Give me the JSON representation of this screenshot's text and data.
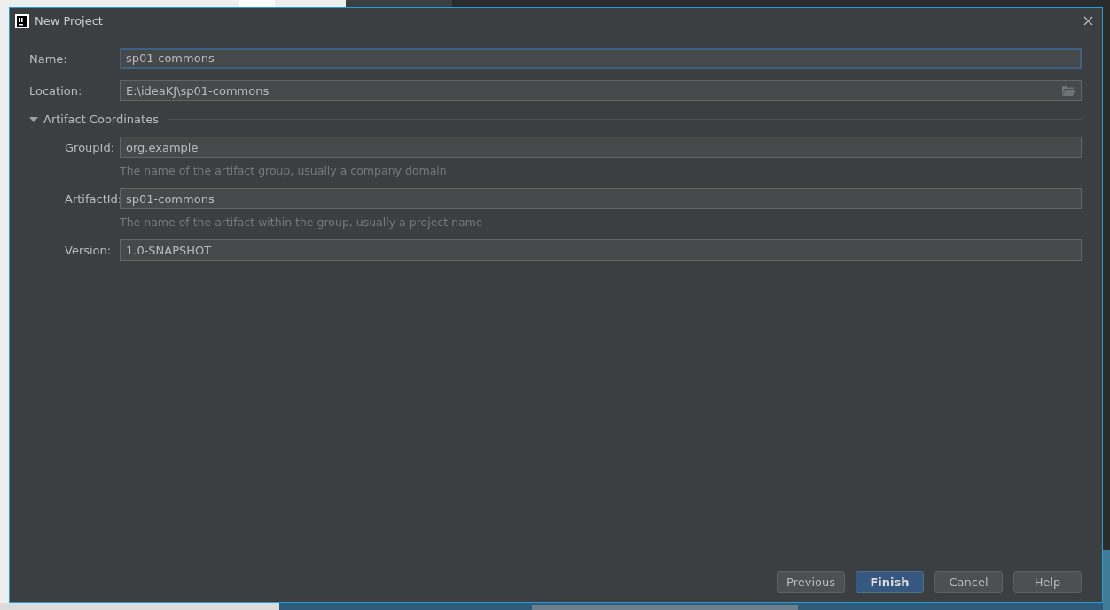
{
  "window": {
    "title": "New Project"
  },
  "fields": [
    {
      "label": "Name:",
      "value": "sp01-commons",
      "focused": true,
      "kind": "text"
    },
    {
      "label": "Location:",
      "value": "E:\\ideaKJ\\sp01-commons",
      "focused": false,
      "kind": "path"
    }
  ],
  "section": {
    "title": "Artifact Coordinates",
    "expanded": true,
    "fields": [
      {
        "label": "GroupId:",
        "value": "org.example",
        "hint": "The name of the artifact group, usually a company domain"
      },
      {
        "label": "ArtifactId:",
        "value": "sp01-commons",
        "hint": "The name of the artifact within the group, usually a project name"
      },
      {
        "label": "Version:",
        "value": "1.0-SNAPSHOT"
      }
    ]
  },
  "buttons": [
    {
      "label": "Previous",
      "default": false
    },
    {
      "label": "Finish",
      "default": true
    },
    {
      "label": "Cancel",
      "default": false
    },
    {
      "label": "Help",
      "default": false
    }
  ]
}
